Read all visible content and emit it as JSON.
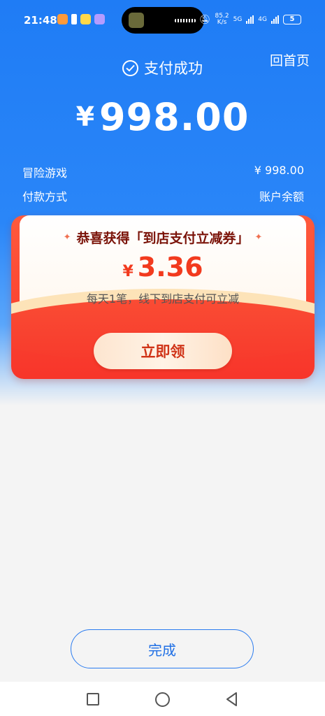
{
  "status_bar": {
    "time": "21:48",
    "net_speed_value": "85.2",
    "net_speed_unit": "K/s",
    "network_5g": "5G",
    "network_4g": "4G",
    "battery": "5"
  },
  "header": {
    "home_label": "回首页",
    "status_text": "支付成功"
  },
  "payment": {
    "currency": "¥",
    "amount": "998.00",
    "item_label": "冒险游戏",
    "item_amount": "¥ 998.00",
    "method_label": "付款方式",
    "method_value": "账户余额"
  },
  "coupon": {
    "title": "恭喜获得「到店支付立减券」",
    "currency": "¥",
    "amount": "3.36",
    "description": "每天1笔，线下到店支付可立减",
    "claim_label": "立即领"
  },
  "footer": {
    "done_label": "完成"
  },
  "colors": {
    "primary_blue": "#2a86f8",
    "coupon_red": "#f7352a",
    "coupon_amount_red": "#f23a1e",
    "done_blue": "#1f6fe5"
  }
}
